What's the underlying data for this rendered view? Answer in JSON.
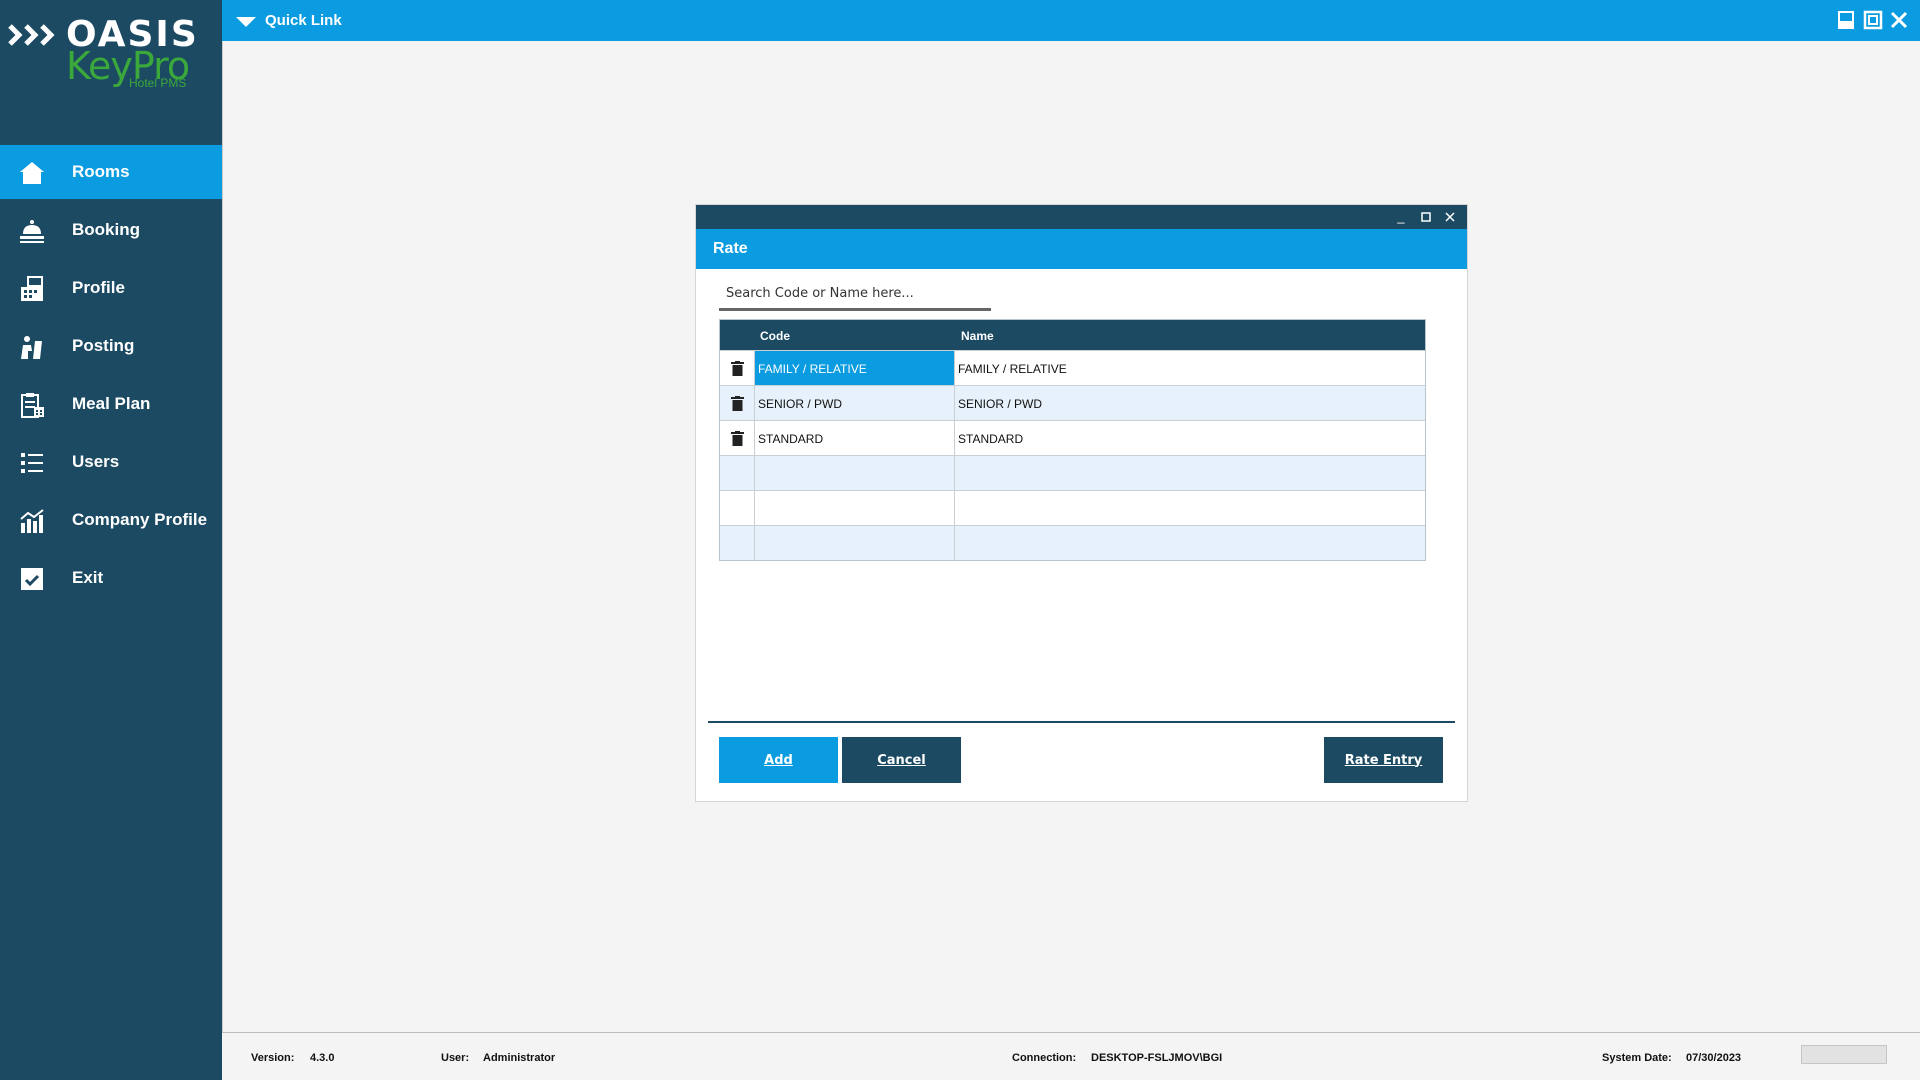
{
  "app": {
    "brand_top": "OASIS",
    "brand_mid": "KeyPro",
    "brand_sub": "Hotel PMS"
  },
  "colors": {
    "accent": "#0a9be0",
    "navy": "#1c4a63"
  },
  "topbar": {
    "quick_link_label": "Quick Link",
    "window_icons": [
      "minimize-icon",
      "maximize-icon",
      "close-icon"
    ]
  },
  "sidebar": {
    "items": [
      {
        "label": "Rooms",
        "icon": "home-icon",
        "active": true
      },
      {
        "label": "Booking",
        "icon": "bell-icon",
        "active": false
      },
      {
        "label": "Profile",
        "icon": "register-icon",
        "active": false
      },
      {
        "label": "Posting",
        "icon": "posting-icon",
        "active": false
      },
      {
        "label": "Meal Plan",
        "icon": "clipboard-icon",
        "active": false
      },
      {
        "label": "Users",
        "icon": "list-icon",
        "active": false
      },
      {
        "label": "Company Profile",
        "icon": "chart-icon",
        "active": false
      },
      {
        "label": "Exit",
        "icon": "exit-icon",
        "active": false
      }
    ]
  },
  "dialog": {
    "title": "Rate",
    "search_placeholder": "Search Code or Name here...",
    "columns": {
      "code": "Code",
      "name": "Name"
    },
    "rows": [
      {
        "code": "FAMILY / RELATIVE",
        "name": "FAMILY / RELATIVE",
        "selected": true
      },
      {
        "code": "SENIOR / PWD",
        "name": "SENIOR / PWD",
        "selected": false
      },
      {
        "code": "STANDARD",
        "name": "STANDARD",
        "selected": false
      },
      {
        "code": "",
        "name": "",
        "selected": false
      },
      {
        "code": "",
        "name": "",
        "selected": false
      },
      {
        "code": "",
        "name": "",
        "selected": false
      }
    ],
    "buttons": {
      "add": "Add",
      "cancel": "Cancel",
      "rate_entry": "Rate Entry"
    }
  },
  "status": {
    "version_label": "Version:",
    "version_value": "4.3.0",
    "user_label": "User:",
    "user_value": "Administrator",
    "connection_label": "Connection:",
    "connection_value": "DESKTOP-FSLJMOV\\BGI",
    "system_date_label": "System Date:",
    "system_date_value": "07/30/2023"
  }
}
